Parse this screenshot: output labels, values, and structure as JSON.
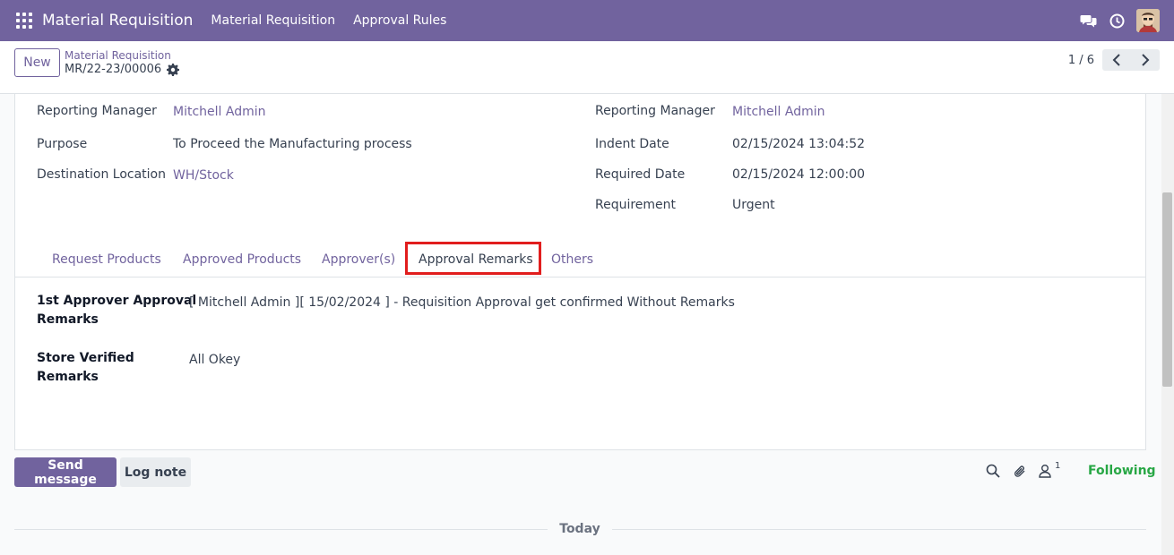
{
  "navbar": {
    "brand": "Material Requisition",
    "menu": [
      "Material Requisition",
      "Approval Rules"
    ]
  },
  "control": {
    "new_label": "New",
    "breadcrumb_parent": "Material Requisition",
    "breadcrumb_current": "MR/22-23/00006",
    "pager": "1 / 6"
  },
  "form": {
    "left": [
      {
        "label": "Reporting Manager",
        "value": "Mitchell Admin"
      },
      {
        "label": "Purpose",
        "value": "To Proceed the Manufacturing process"
      },
      {
        "label": "Destination Location",
        "value": "WH/Stock"
      }
    ],
    "right": [
      {
        "label": "Reporting Manager",
        "value": "Mitchell Admin"
      },
      {
        "label": "Indent Date",
        "value": "02/15/2024 13:04:52"
      },
      {
        "label": "Required Date",
        "value": "02/15/2024 12:00:00"
      },
      {
        "label": "Requirement",
        "value": "Urgent"
      }
    ]
  },
  "tabs": [
    "Request Products",
    "Approved Products",
    "Approver(s)",
    "Approval Remarks",
    "Others"
  ],
  "active_tab": "Approval Remarks",
  "remarks": [
    {
      "label_line1": "1st Approver Approval",
      "label_line2": "Remarks",
      "value": "[ Mitchell Admin ][ 15/02/2024 ] - Requisition Approval get confirmed Without Remarks"
    },
    {
      "label_line1": "Store Verified",
      "label_line2": "Remarks",
      "value": "All Okey"
    }
  ],
  "chatter": {
    "send_label": "Send message",
    "log_label": "Log note",
    "followers_count": "1",
    "following_label": "Following",
    "today_label": "Today"
  },
  "colors": {
    "brand": "#71639e",
    "highlight": "#e11d1d",
    "following": "#28a745"
  }
}
